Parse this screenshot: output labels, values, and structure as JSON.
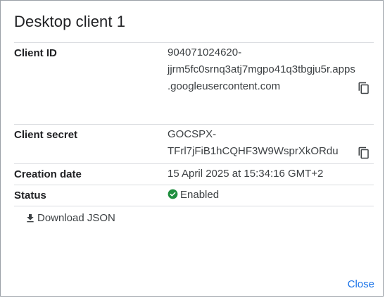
{
  "dialog": {
    "title": "Desktop client 1",
    "client_id": {
      "label": "Client ID",
      "line1": "904071024620-",
      "line2": "jjrm5fc0srnq3atj7mgpo41q3tbgju5r.apps",
      "line3": ".googleusercontent.com"
    },
    "client_secret": {
      "label": "Client secret",
      "line1": "GOCSPX-",
      "line2": "TFrl7jFiB1hCQHF3W9WsprXkORdu"
    },
    "creation_date": {
      "label": "Creation date",
      "value": "15 April 2025 at 15:34:16 GMT+2"
    },
    "status": {
      "label": "Status",
      "value": "Enabled",
      "icon": "check-circle-icon",
      "color": "#1e8e3e"
    },
    "download_label": "Download JSON",
    "close_label": "Close",
    "accent_color": "#1a73e8"
  }
}
